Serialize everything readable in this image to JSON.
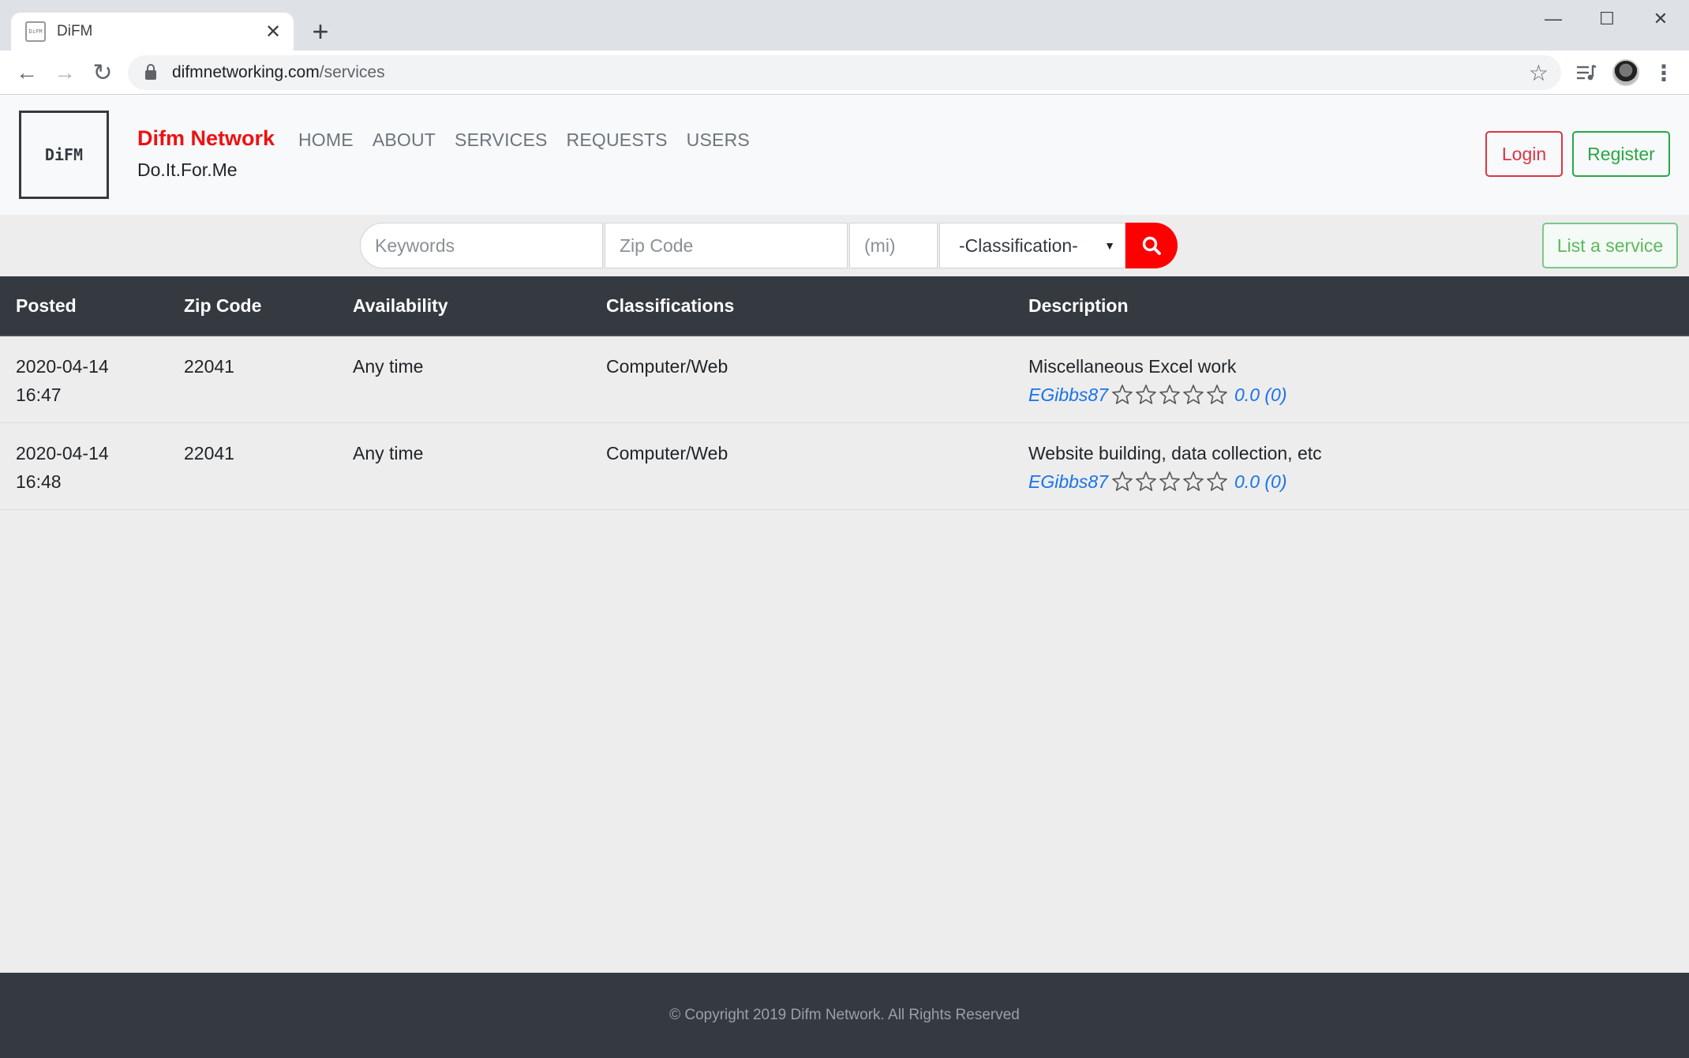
{
  "browser": {
    "tab_title": "DiFM",
    "favicon_text": "DiFM",
    "url_domain": "difmnetworking.com",
    "url_path": "/services"
  },
  "site": {
    "logo_text": "DiFM",
    "brand_name": "Difm Network",
    "tagline": "Do.It.For.Me",
    "nav": [
      "HOME",
      "ABOUT",
      "SERVICES",
      "REQUESTS",
      "USERS"
    ],
    "login_label": "Login",
    "register_label": "Register"
  },
  "search": {
    "keywords_placeholder": "Keywords",
    "zip_placeholder": "Zip Code",
    "distance_placeholder": "(mi)",
    "classification_selected": "-Classification-",
    "list_service_label": "List a service"
  },
  "table": {
    "headers": [
      "Posted",
      "Zip Code",
      "Availability",
      "Classifications",
      "Description"
    ],
    "rows": [
      {
        "posted_date": "2020-04-14",
        "posted_time": "16:47",
        "zip": "22041",
        "availability": "Any time",
        "classification": "Computer/Web",
        "description": "Miscellaneous Excel work",
        "user": "EGibbs87",
        "rating": "0.0",
        "rating_count": "(0)",
        "stars_filled": 0
      },
      {
        "posted_date": "2020-04-14",
        "posted_time": "16:48",
        "zip": "22041",
        "availability": "Any time",
        "classification": "Computer/Web",
        "description": "Website building, data collection, etc",
        "user": "EGibbs87",
        "rating": "0.0",
        "rating_count": "(0)",
        "stars_filled": 0
      }
    ]
  },
  "footer": {
    "copyright": "© Copyright 2019 Difm Network. All Rights Reserved"
  },
  "colors": {
    "brand_red": "#ee1111",
    "search_button": "#ff0000",
    "login": "#dc3545",
    "register": "#28a745",
    "header_dark": "#343a40",
    "link_blue": "#1a73e8"
  }
}
